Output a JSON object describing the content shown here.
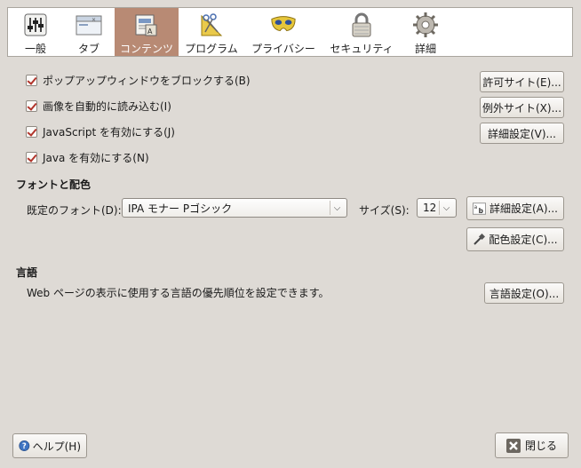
{
  "tabs": [
    {
      "label": "一般",
      "icon": "sliders-icon"
    },
    {
      "label": "タブ",
      "icon": "window-tab-icon"
    },
    {
      "label": "コンテンツ",
      "icon": "content-page-icon",
      "selected": true
    },
    {
      "label": "プログラム",
      "icon": "scissors-ruler-icon"
    },
    {
      "label": "プライバシー",
      "icon": "mask-icon"
    },
    {
      "label": "セキュリティ",
      "icon": "padlock-icon"
    },
    {
      "label": "詳細",
      "icon": "gear-icon"
    }
  ],
  "content": {
    "block_popups": {
      "label": "ポップアップウィンドウをブロックする(B)",
      "checked": true,
      "button": "許可サイト(E)..."
    },
    "load_images": {
      "label": "画像を自動的に読み込む(I)",
      "checked": true,
      "button": "例外サイト(X)..."
    },
    "javascript": {
      "label": "JavaScript を有効にする(J)",
      "checked": true,
      "button": "詳細設定(V)..."
    },
    "java": {
      "label": "Java を有効にする(N)",
      "checked": true
    }
  },
  "fonts": {
    "heading": "フォントと配色",
    "default_font_label": "既定のフォント(D):",
    "default_font_value": "IPA モナー Pゴシック",
    "size_label": "サイズ(S):",
    "size_value": "12",
    "advanced_button": "詳細設定(A)...",
    "colors_button": "配色設定(C)..."
  },
  "languages": {
    "heading": "言語",
    "description": "Web ページの表示に使用する言語の優先順位を設定できます。",
    "button": "言語設定(O)..."
  },
  "footer": {
    "help_button": "ヘルプ(H)",
    "close_button": "閉じる"
  },
  "colors": {
    "selected_tab": "#b88a74",
    "checkbox_check": "#b1342b",
    "background": "#dedad5"
  }
}
